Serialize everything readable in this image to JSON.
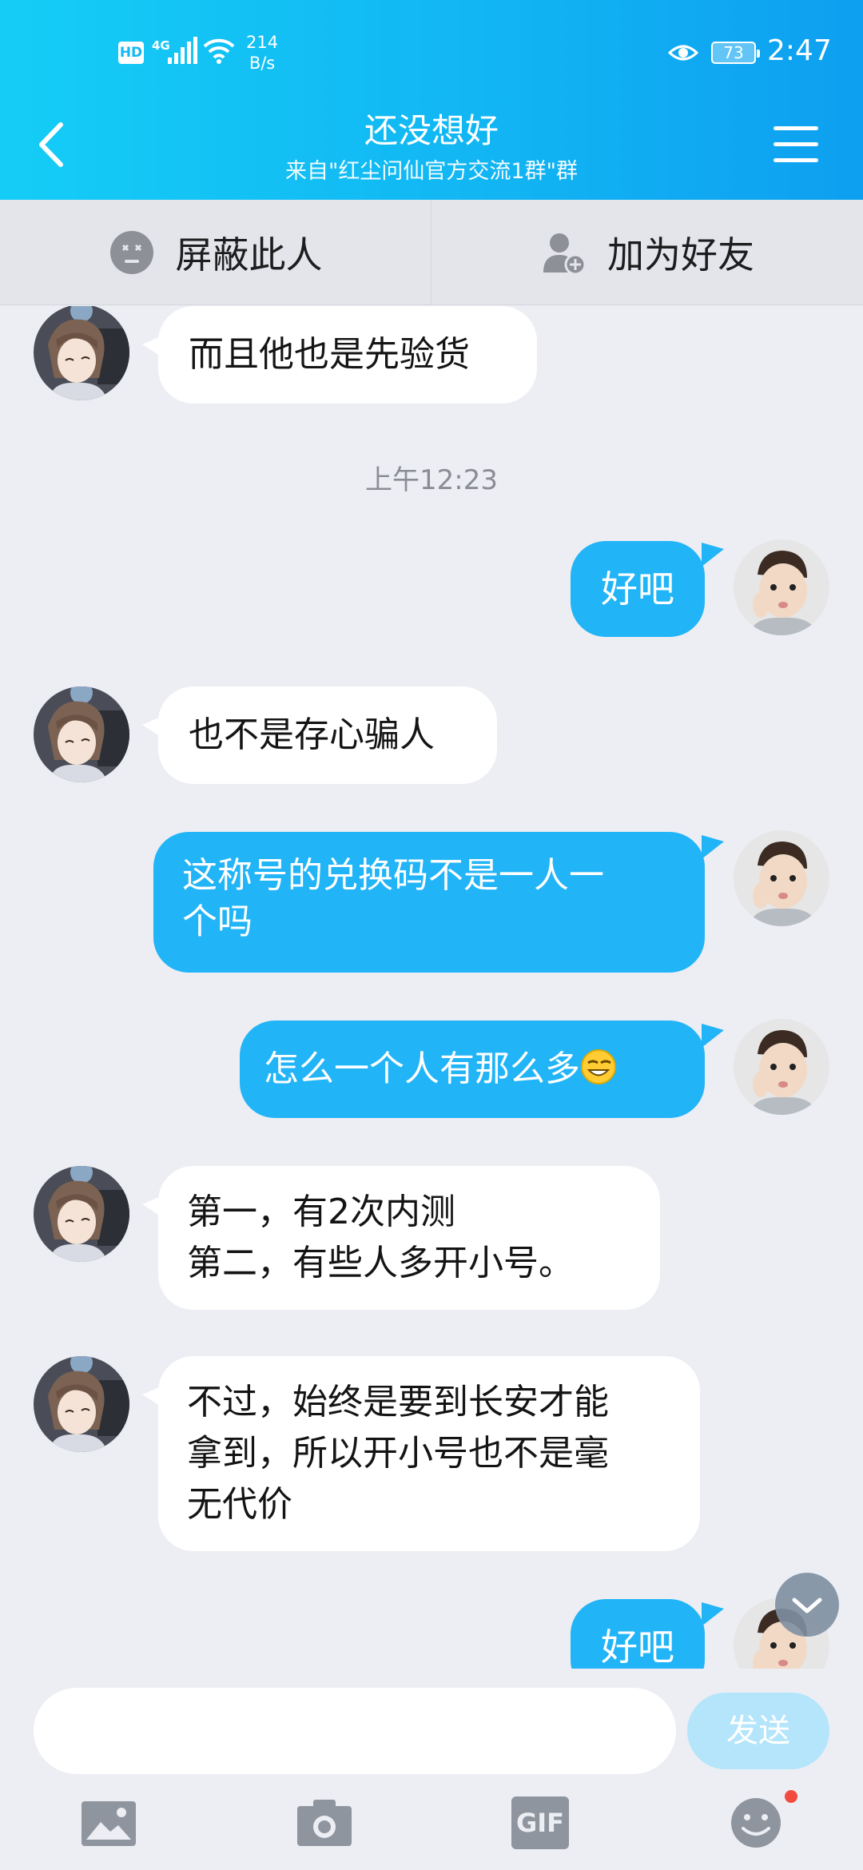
{
  "status_bar": {
    "hd": "HD",
    "network": "4G",
    "speed_value": "214",
    "speed_unit": "B/s",
    "battery": "73",
    "time": "2:47"
  },
  "header": {
    "title": "还没想好",
    "subtitle": "来自\"红尘问仙官方交流1群\"群"
  },
  "actions": {
    "block": "屏蔽此人",
    "add_friend": "加为好友"
  },
  "messages": [
    {
      "from": "other",
      "text": "而且他也是先验货"
    },
    {
      "from": "timestamp",
      "text": "上午12:23"
    },
    {
      "from": "me",
      "text": "好吧"
    },
    {
      "from": "other",
      "text": "也不是存心骗人"
    },
    {
      "from": "me",
      "text": "这称号的兑换码不是一人一\n个吗"
    },
    {
      "from": "me",
      "text": "怎么一个人有那么多",
      "emoji": "grinning-face-icon"
    },
    {
      "from": "other",
      "text": "第一，有2次内测\n第二，有些人多开小号。"
    },
    {
      "from": "other",
      "text": "不过，始终是要到长安才能\n拿到，所以开小号也不是毫\n无代价"
    },
    {
      "from": "me",
      "text": "好吧"
    }
  ],
  "input": {
    "placeholder": "",
    "send_label": "发送"
  },
  "toolbar": {
    "gif_label": "GIF"
  },
  "colors": {
    "header_start": "#14cdf6",
    "header_end": "#0d9ff0",
    "out_bubble": "#21b4f7",
    "in_bubble": "#ffffff",
    "send_disabled": "#b4e5fb",
    "badge": "#f24b3e"
  }
}
